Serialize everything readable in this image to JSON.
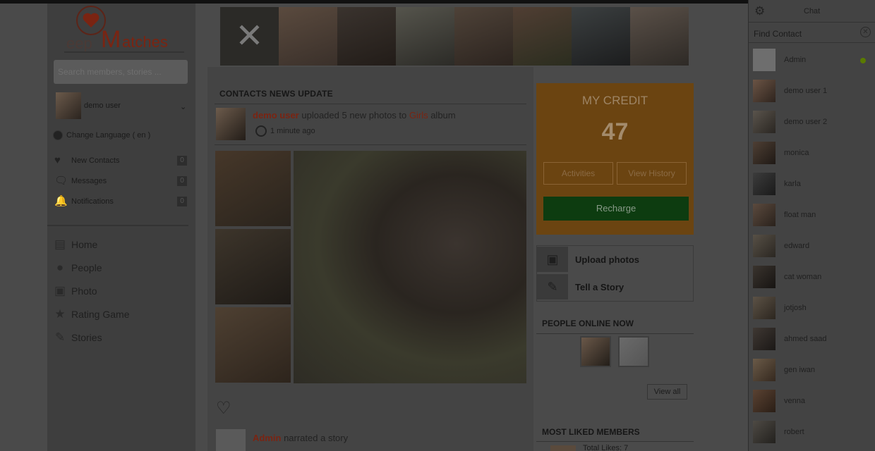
{
  "logo": {
    "text": "Peep Matches",
    "brand_color": "#7a2412"
  },
  "search": {
    "placeholder": "Search members, stories ..."
  },
  "user": {
    "name": "demo user"
  },
  "language": {
    "label": "Change Language ( en )"
  },
  "mini_menu": [
    {
      "label": "New Contacts",
      "count": "0",
      "icon": "heart-icon"
    },
    {
      "label": "Messages",
      "count": "0",
      "icon": "chat-bubble-icon"
    },
    {
      "label": "Notifications",
      "count": "0",
      "icon": "bell-icon"
    }
  ],
  "nav": [
    {
      "label": "Home",
      "icon": "rss-icon"
    },
    {
      "label": "People",
      "icon": "person-icon"
    },
    {
      "label": "Photo",
      "icon": "camera-icon"
    },
    {
      "label": "Rating Game",
      "icon": "star-icon"
    },
    {
      "label": "Stories",
      "icon": "pencil-icon"
    }
  ],
  "feed": {
    "heading": "CONTACTS NEWS UPDATE",
    "post1": {
      "user": "demo user",
      "text_mid": " uploaded 5 new photos to ",
      "album": "Girls",
      "text_end": " album",
      "time": "1 minute ago"
    },
    "post2": {
      "user": "Admin",
      "text": " narrated a story"
    }
  },
  "credit": {
    "title": "MY CREDIT",
    "amount": "47",
    "activities": "Activities",
    "history": "View History",
    "recharge": "Recharge",
    "bg_color": "#6b4411",
    "recharge_color": "#0d3c10"
  },
  "actions": {
    "upload": "Upload photos",
    "story": "Tell a Story"
  },
  "online": {
    "heading": "PEOPLE ONLINE NOW",
    "view_all": "View all"
  },
  "liked": {
    "heading": "MOST LIKED MEMBERS",
    "total": "Total Likes: 7"
  },
  "chat": {
    "title": "Chat",
    "find": "Find Contact",
    "contacts": [
      {
        "name": "Admin",
        "online": true
      },
      {
        "name": "demo user 1"
      },
      {
        "name": "demo user 2"
      },
      {
        "name": "monica"
      },
      {
        "name": "karla"
      },
      {
        "name": "float man"
      },
      {
        "name": "edward"
      },
      {
        "name": "cat woman"
      },
      {
        "name": "jotjosh"
      },
      {
        "name": "ahmed saad"
      },
      {
        "name": "gen iwan"
      },
      {
        "name": "venna"
      },
      {
        "name": "robert"
      }
    ]
  }
}
